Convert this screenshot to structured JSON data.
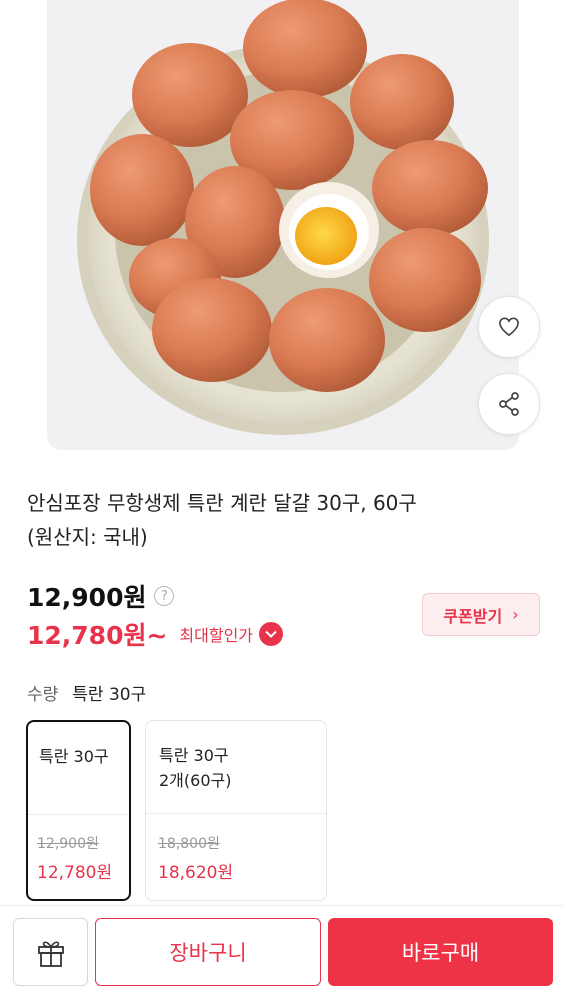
{
  "product": {
    "image_alt": "eggs in bowl",
    "title_line1": "안심포장 무항생제 특란 계란 달걀 30구, 60구",
    "title_line2": "(원산지: 국내)"
  },
  "actions": {
    "wishlist_icon": "heart-icon",
    "share_icon": "share-icon"
  },
  "price": {
    "original": "12,900원",
    "help_glyph": "?",
    "sale": "12,780원~",
    "max_discount_label": "최대할인가",
    "coupon_label": "쿠폰받기",
    "coupon_arrow": "›"
  },
  "quantity": {
    "label": "수량",
    "value": "특란 30구"
  },
  "options": [
    {
      "name": "특란 30구",
      "original": "12,900원",
      "sale": "12,780원",
      "selected": true
    },
    {
      "name": "특란 30구\n2개(60구)",
      "original": "18,800원",
      "sale": "18,620원",
      "selected": false
    }
  ],
  "bottom": {
    "gift_icon": "gift-icon",
    "cart_label": "장바구니",
    "buy_label": "바로구매"
  },
  "colors": {
    "accent": "#e8334a",
    "buy_button": "#ee3347"
  }
}
